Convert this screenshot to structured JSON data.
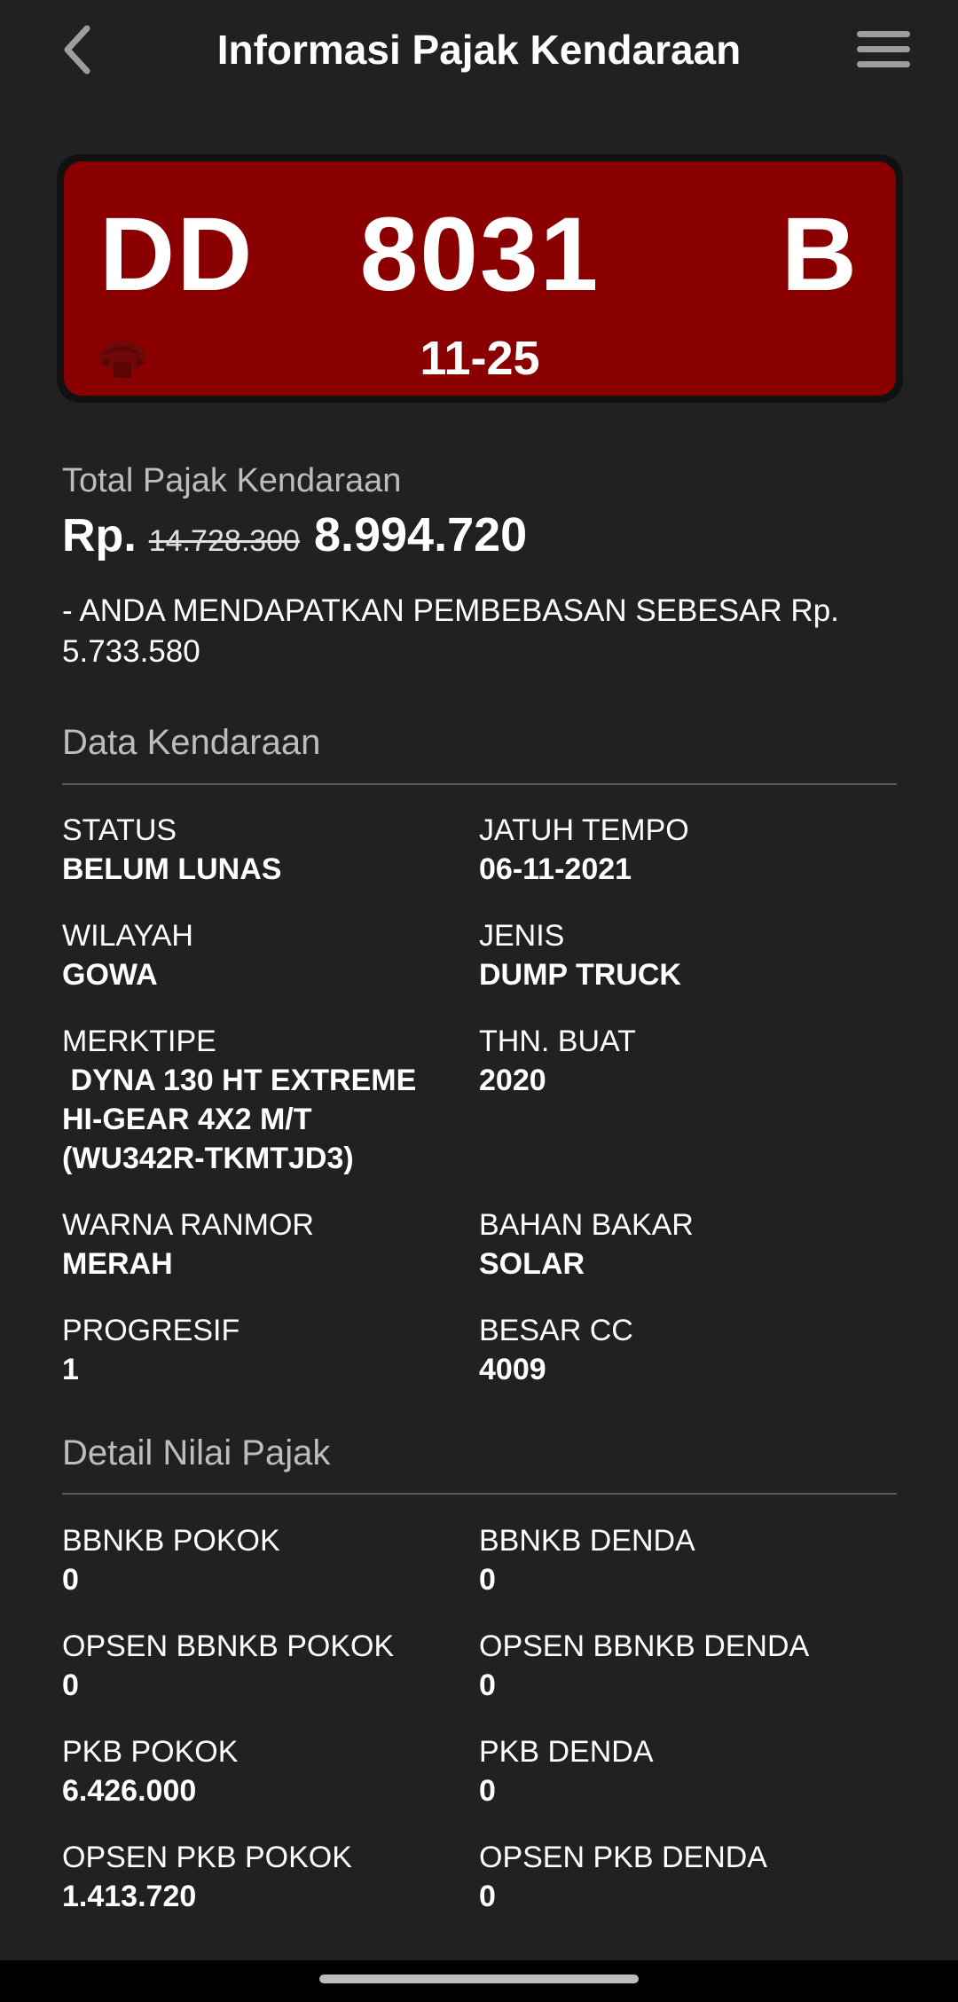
{
  "header": {
    "title": "Informasi Pajak Kendaraan",
    "back_icon": "back-arrow-icon",
    "menu_icon": "hamburger-menu-icon"
  },
  "plate": {
    "area_code": "DD",
    "number": "8031",
    "suffix": "B",
    "expiry": "11-25",
    "background_color": "#8a0000"
  },
  "total": {
    "label": "Total Pajak Kendaraan",
    "prefix": "Rp.",
    "original_amount": "14.728.300",
    "amount": "8.994.720",
    "discount_note": "- ANDA MENDAPATKAN PEMBEBASAN SEBESAR Rp. 5.733.580"
  },
  "vehicle": {
    "title": "Data Kendaraan",
    "fields": [
      {
        "label": "STATUS",
        "value": "BELUM LUNAS"
      },
      {
        "label": "JATUH TEMPO",
        "value": "06-11-2021"
      },
      {
        "label": "WILAYAH",
        "value": "GOWA"
      },
      {
        "label": "JENIS",
        "value": "DUMP TRUCK"
      },
      {
        "label": "MERKTIPE",
        "value": " DYNA 130 HT EXTREME\nHI-GEAR 4X2 M/T\n(WU342R-TKMTJD3)"
      },
      {
        "label": "THN. BUAT",
        "value": "2020"
      },
      {
        "label": "WARNA RANMOR",
        "value": "MERAH"
      },
      {
        "label": "BAHAN BAKAR",
        "value": "SOLAR"
      },
      {
        "label": "PROGRESIF",
        "value": "1"
      },
      {
        "label": "BESAR CC",
        "value": "4009"
      }
    ]
  },
  "tax_detail": {
    "title": "Detail Nilai Pajak",
    "fields": [
      {
        "label": "BBNKB POKOK",
        "value": "0"
      },
      {
        "label": "BBNKB DENDA",
        "value": "0"
      },
      {
        "label": "OPSEN BBNKB POKOK",
        "value": "0"
      },
      {
        "label": "OPSEN BBNKB DENDA",
        "value": "0"
      },
      {
        "label": "PKB POKOK",
        "value": "6.426.000"
      },
      {
        "label": "PKB DENDA",
        "value": "0"
      },
      {
        "label": "OPSEN PKB POKOK",
        "value": "1.413.720"
      },
      {
        "label": "OPSEN PKB DENDA",
        "value": "0"
      }
    ]
  }
}
